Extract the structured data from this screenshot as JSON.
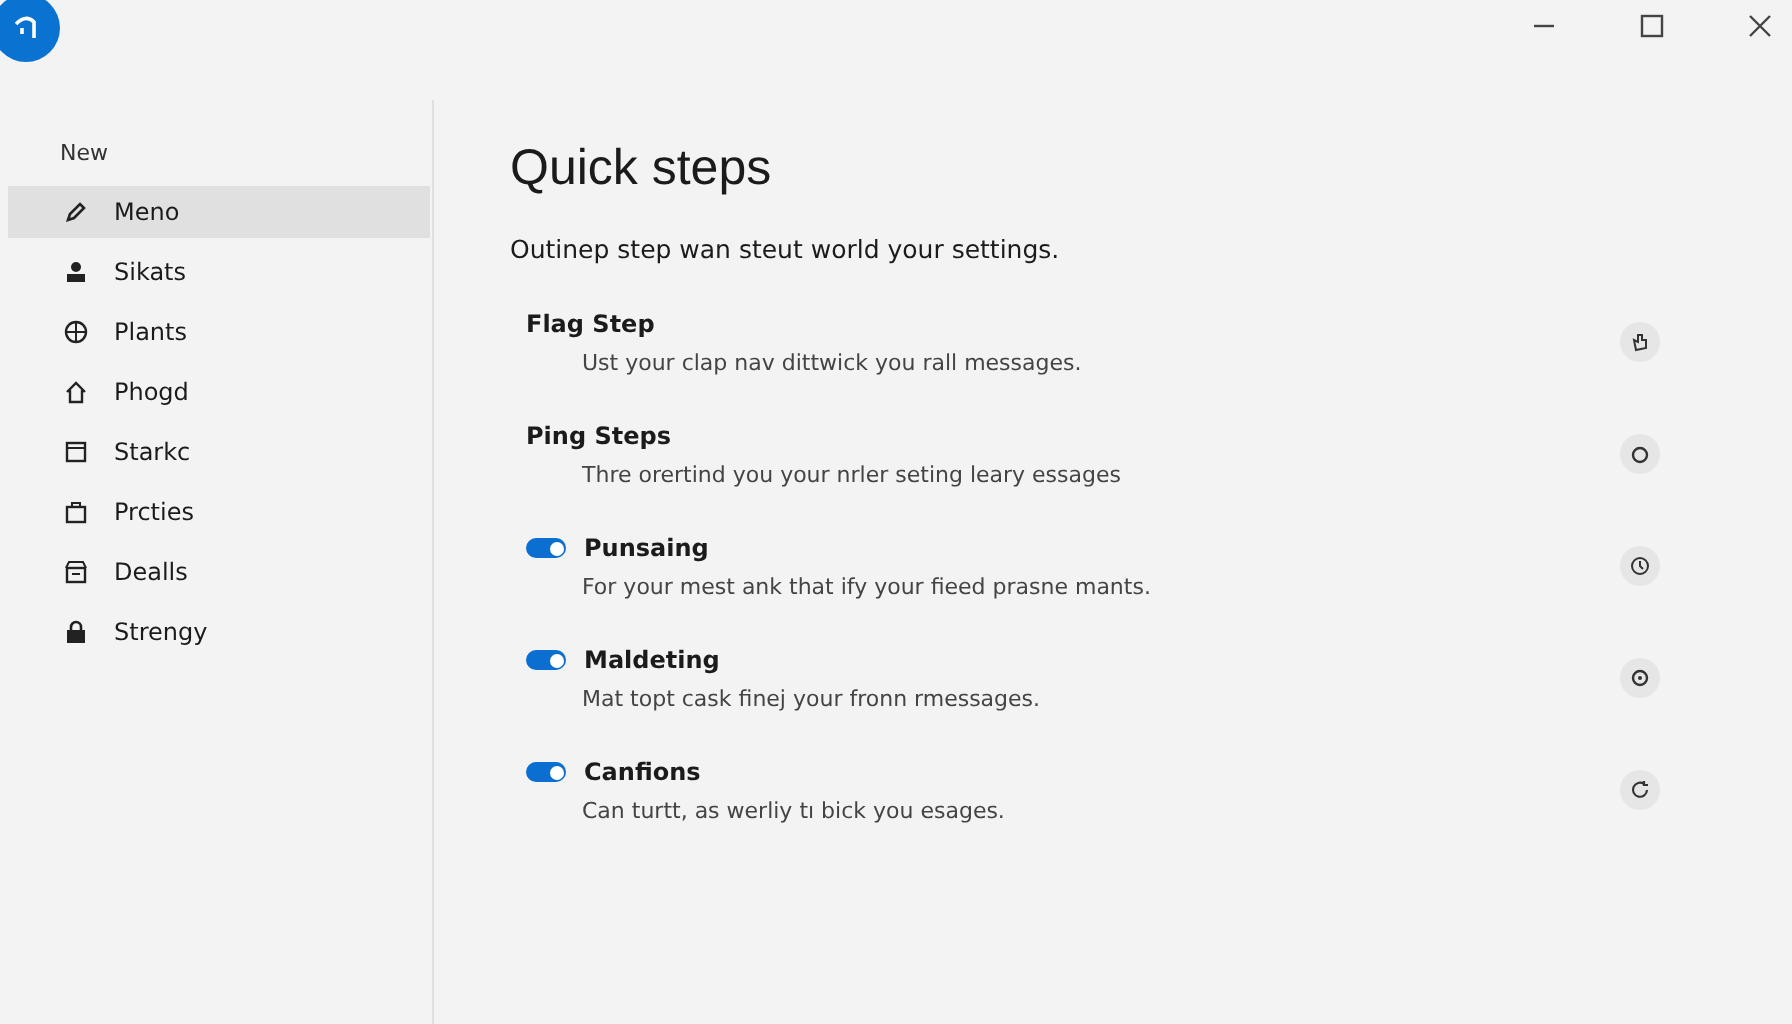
{
  "sidebar": {
    "heading": "New",
    "items": [
      {
        "label": "Meno",
        "selected": true
      },
      {
        "label": "Sikats",
        "selected": false
      },
      {
        "label": "Plants",
        "selected": false
      },
      {
        "label": "Phogd",
        "selected": false
      },
      {
        "label": "Starkc",
        "selected": false
      },
      {
        "label": "Prcties",
        "selected": false
      },
      {
        "label": "Dealls",
        "selected": false
      },
      {
        "label": "Strengy",
        "selected": false
      }
    ]
  },
  "main": {
    "title": "Quick steps",
    "subtitle": "Outinep step wan steut world your settings.",
    "steps": [
      {
        "kind": "plain",
        "title": "Flag Step",
        "description": "Ust your clap nav dittwick you rall messages."
      },
      {
        "kind": "plain",
        "title": "Ping Steps",
        "description": "Thre orertind you your nrler seting leary essages"
      },
      {
        "kind": "toggle",
        "on": true,
        "title": "Punsaing",
        "description": "For your mest ank that ify your fieed prasne mants."
      },
      {
        "kind": "toggle",
        "on": true,
        "title": "Maldeting",
        "description": "Mat topt cask finej your fronn rmessages."
      },
      {
        "kind": "toggle",
        "on": true,
        "title": "Canfions",
        "description": "Can turtt, as werliy tı bick you esages."
      }
    ]
  }
}
